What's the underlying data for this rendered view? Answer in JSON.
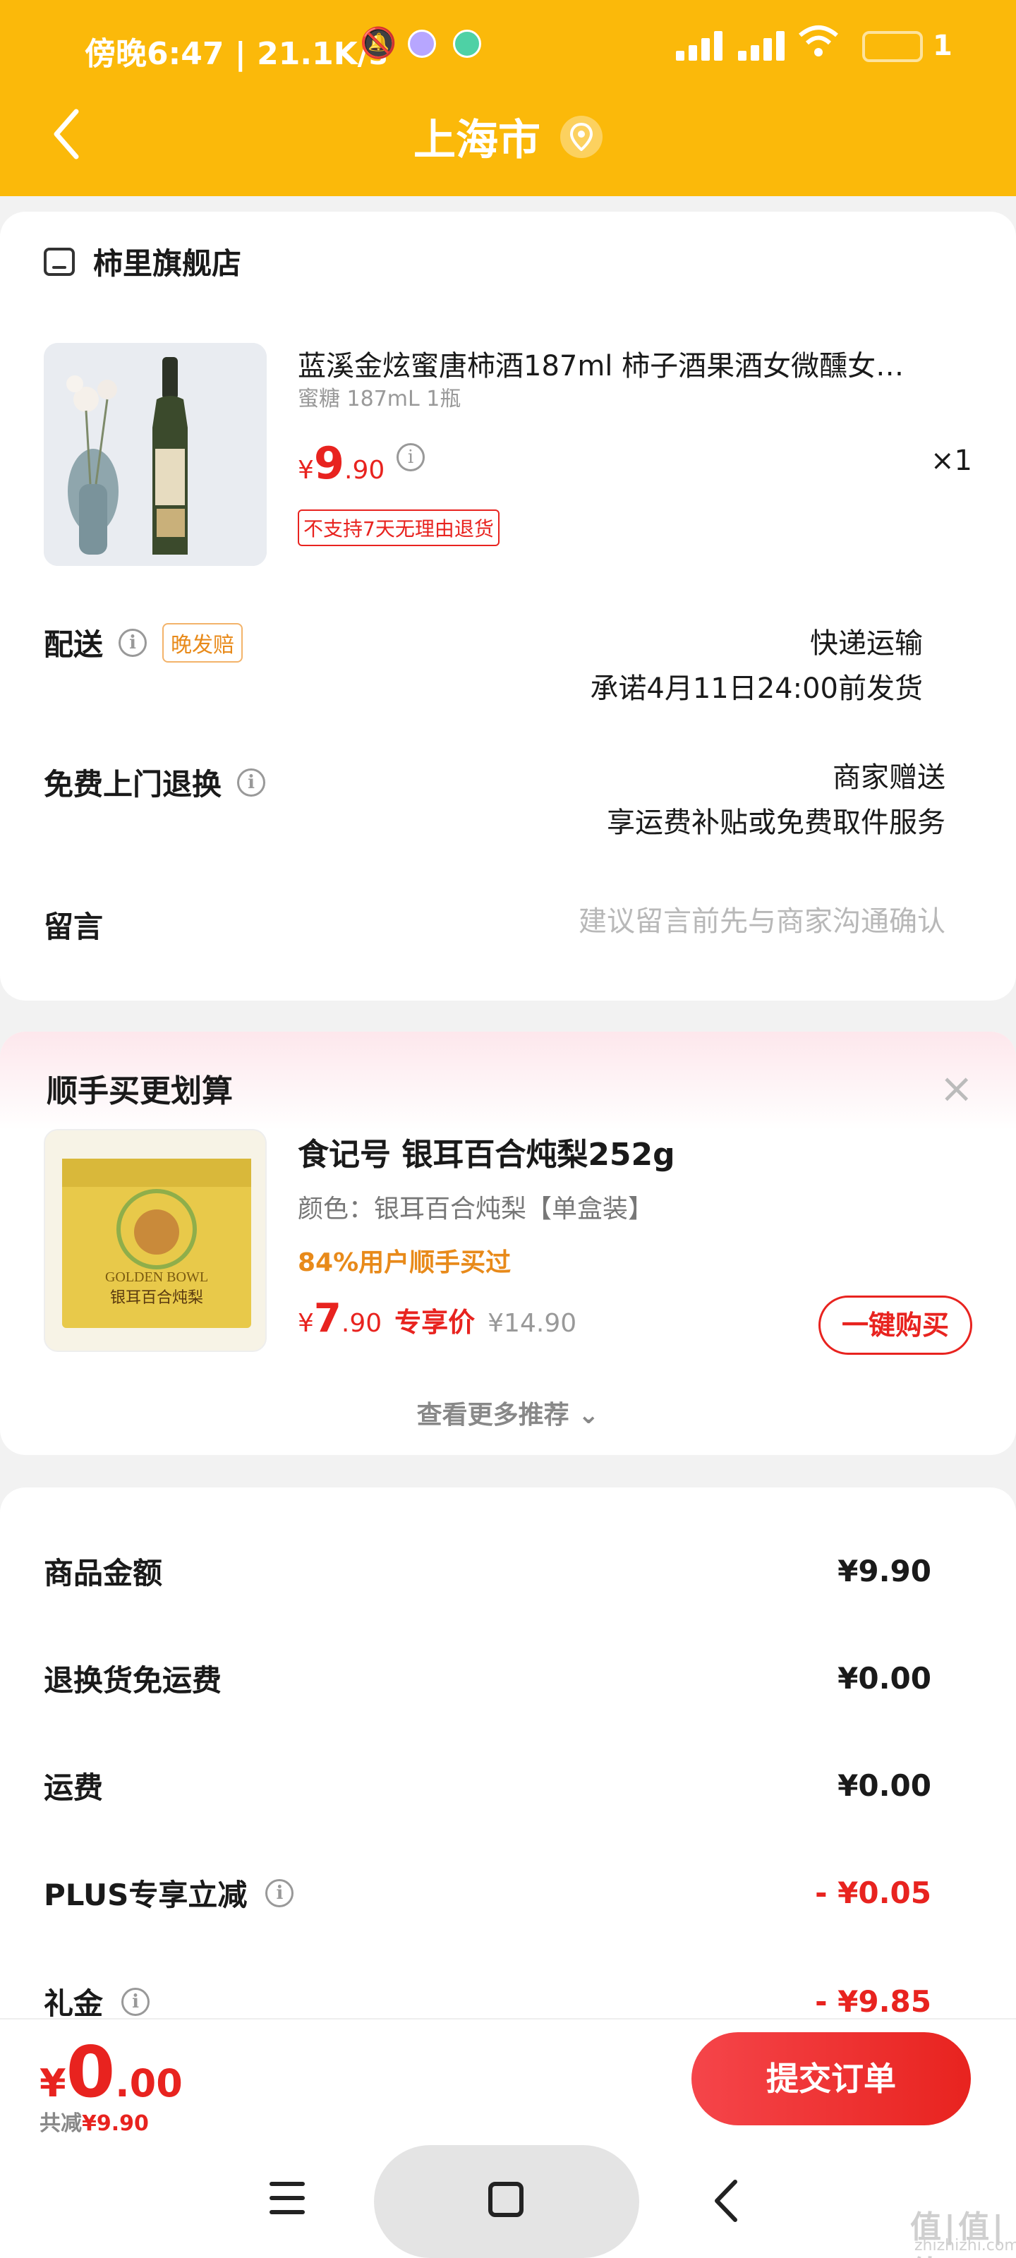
{
  "status_bar": {
    "time": "傍晚6:47 | 21.1K/s",
    "battery": "1"
  },
  "header": {
    "title": "上海市"
  },
  "shop": {
    "name": "柿里旗舰店"
  },
  "product": {
    "title": "蓝溪金炫蜜唐柿酒187ml 柿子酒果酒女微醺女…",
    "spec": "蜜糖 187mL 1瓶",
    "currency": "¥",
    "price_int": "9",
    "price_dec": ".90",
    "qty": "×1",
    "return_tag": "不支持7天无理由退货"
  },
  "delivery": {
    "label": "配送",
    "tag": "晚发赔",
    "method": "快递运输",
    "promise": "承诺4月11日24:00前发货"
  },
  "free_return": {
    "label": "免费上门退换",
    "line1": "商家赠送",
    "line2": "享运费补贴或免费取件服务"
  },
  "message": {
    "label": "留言",
    "placeholder": "建议留言前先与商家沟通确认"
  },
  "recommend": {
    "title": "顺手买更划算",
    "close": "×",
    "item_title": "食记号 银耳百合炖梨252g",
    "item_color": "颜色：银耳百合炖梨【单盒装】",
    "item_pct": "84%用户顺手买过",
    "currency": "¥",
    "price_int": "7",
    "price_dec": ".90",
    "vip_label": "专享价",
    "old_price": "¥14.90",
    "buy_label": "一键购买",
    "more": "查看更多推荐 ⌄",
    "box_text_top": "GOLDEN BOWL",
    "box_text_cn": "银耳百合炖梨"
  },
  "summary": {
    "rows": [
      {
        "label": "商品金额",
        "value": "¥9.90"
      },
      {
        "label": "退换货免运费",
        "value": "¥0.00"
      },
      {
        "label": "运费",
        "value": "¥0.00"
      },
      {
        "label": "PLUS专享立减",
        "value": "- ¥0.05"
      },
      {
        "label": "礼金",
        "value": "- ¥9.85"
      }
    ]
  },
  "bottom": {
    "currency": "¥",
    "total_int": "0",
    "total_dec": ".00",
    "saved_label": "共减",
    "saved_value": "¥9.90",
    "submit": "提交订单"
  },
  "watermark": {
    "main": "值|值|值",
    "sub": "zhizhizhi.com"
  },
  "colors": {
    "brand_yellow": "#fbb90a",
    "price_red": "#e8231f",
    "orange": "#e88a1a"
  }
}
